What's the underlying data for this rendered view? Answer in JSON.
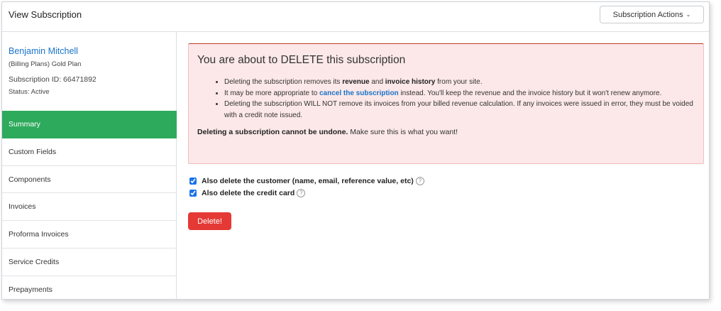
{
  "header": {
    "title": "View Subscription",
    "actions_label": "Subscription Actions",
    "caret": "⌄"
  },
  "customer": {
    "name": "Benjamin Mitchell",
    "plan": "(Billing Plans) Gold Plan",
    "subscription_id": "Subscription ID: 66471892",
    "status": "Status: Active"
  },
  "sidebar": {
    "items": [
      {
        "label": "Summary",
        "active": true
      },
      {
        "label": "Custom Fields"
      },
      {
        "label": "Components"
      },
      {
        "label": "Invoices"
      },
      {
        "label": "Proforma Invoices"
      },
      {
        "label": "Service Credits"
      },
      {
        "label": "Prepayments"
      }
    ]
  },
  "alert": {
    "title": "You are about to DELETE this subscription",
    "b1_pre": "Deleting the subscription removes its ",
    "b1_revenue": "revenue",
    "b1_and": " and ",
    "b1_history": "invoice history",
    "b1_post": " from your site.",
    "b2_pre": "It may be more appropriate to ",
    "b2_link": "cancel the subscription",
    "b2_post": " instead. You'll keep the revenue and the invoice history but it won't renew anymore.",
    "b3": "Deleting the subscription WILL NOT remove its invoices from your billed revenue calculation. If any invoices were issued in error, they must be voided with a credit note issued.",
    "footer_bold": "Deleting a subscription cannot be undone.",
    "footer_rest": " Make sure this is what you want!"
  },
  "options": {
    "delete_customer_label": "Also delete the customer (name, email, reference value, etc)",
    "delete_card_label": "Also delete the credit card",
    "help": "?"
  },
  "delete_button": "Delete!",
  "colors": {
    "accent_green": "#2eaa5c",
    "link_blue": "#1a73c9",
    "danger_red": "#e53935",
    "alert_bg": "#fce8e8"
  }
}
